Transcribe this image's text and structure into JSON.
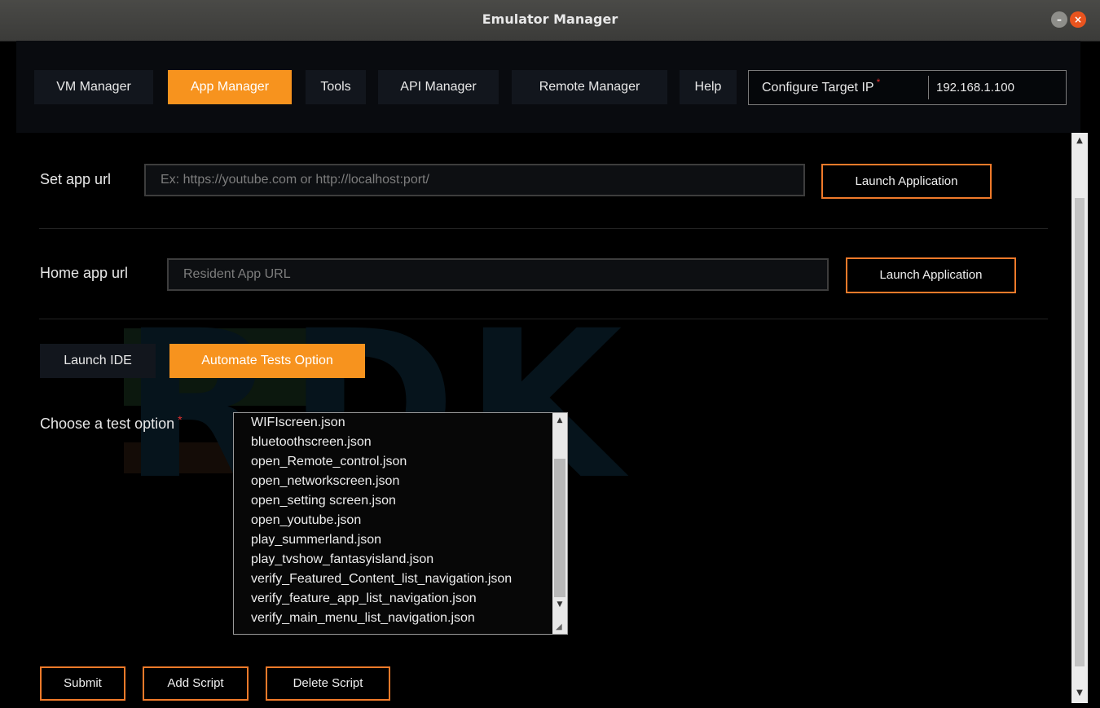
{
  "window": {
    "title": "Emulator Manager"
  },
  "nav": {
    "items": [
      {
        "label": "VM Manager",
        "active": false
      },
      {
        "label": "App Manager",
        "active": true
      },
      {
        "label": "Tools",
        "active": false
      },
      {
        "label": "API Manager",
        "active": false
      },
      {
        "label": "Remote Manager",
        "active": false
      },
      {
        "label": "Help",
        "active": false
      }
    ],
    "target_ip": {
      "label": "Configure Target IP",
      "required_mark": "*",
      "value": "192.168.1.100"
    }
  },
  "app_url": {
    "label": "Set app url",
    "placeholder": "Ex: https://youtube.com or http://localhost:port/",
    "button": "Launch Application"
  },
  "home_url": {
    "label": "Home app url",
    "placeholder": "Resident App URL",
    "button": "Launch Application"
  },
  "tabs": [
    {
      "label": "Launch IDE",
      "active": false
    },
    {
      "label": "Automate Tests Option",
      "active": true
    }
  ],
  "test_option": {
    "label": "Choose a test option",
    "required_mark": "*",
    "items": [
      "WIFIscreen.json",
      "bluetoothscreen.json",
      "open_Remote_control.json",
      "open_networkscreen.json",
      "open_setting screen.json",
      "open_youtube.json",
      "play_summerland.json",
      "play_tvshow_fantasyisland.json",
      "verify_Featured_Content_list_navigation.json",
      "verify_feature_app_list_navigation.json",
      "verify_main_menu_list_navigation.json"
    ]
  },
  "actions": {
    "submit": "Submit",
    "add_script": "Add Script",
    "delete_script": "Delete Script"
  },
  "watermark": "RDK",
  "colors": {
    "accent": "#f7931e",
    "button_border": "#f07a2a",
    "required": "#e03030"
  }
}
